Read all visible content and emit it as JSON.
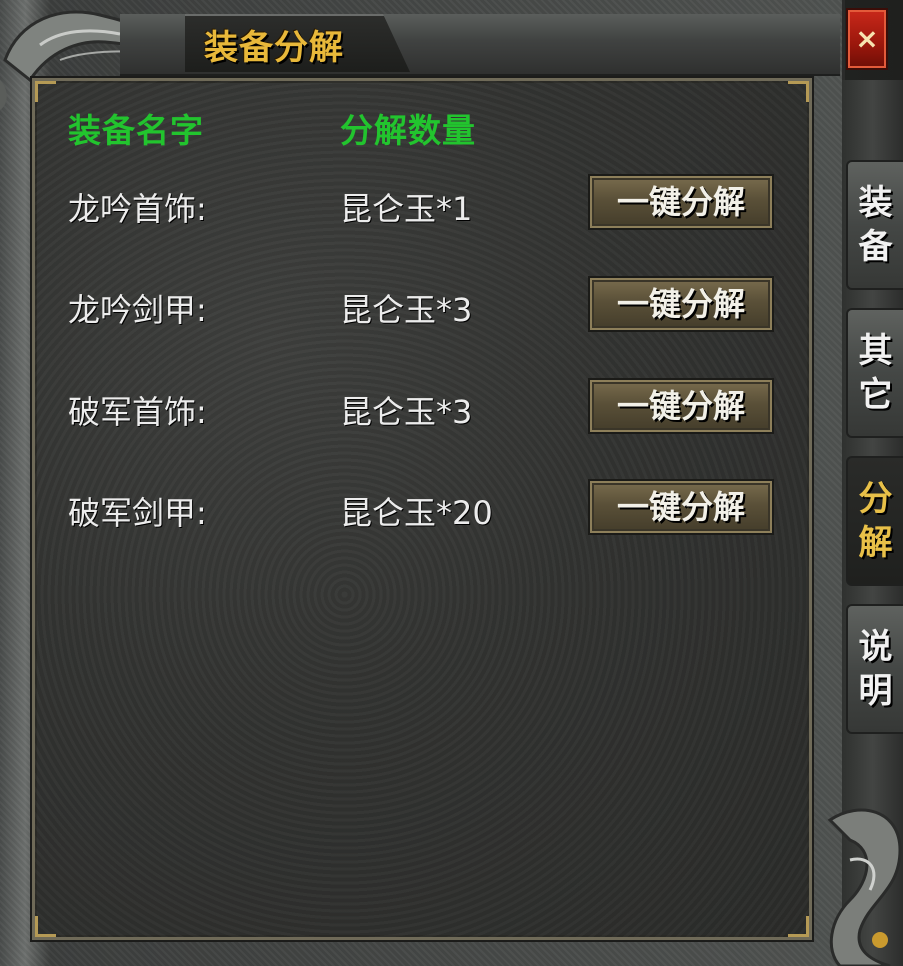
{
  "window": {
    "title": "装备分解",
    "close_label": "×"
  },
  "columns": {
    "name_header": "装备名字",
    "quantity_header": "分解数量"
  },
  "rows": [
    {
      "name": "龙吟首饰:",
      "quantity": "昆仑玉*1",
      "button": "一键分解"
    },
    {
      "name": "龙吟剑甲:",
      "quantity": "昆仑玉*3",
      "button": "一键分解"
    },
    {
      "name": "破军首饰:",
      "quantity": "昆仑玉*3",
      "button": "一键分解"
    },
    {
      "name": "破军剑甲:",
      "quantity": "昆仑玉*20",
      "button": "一键分解"
    }
  ],
  "side_tabs": [
    {
      "label_1": "装",
      "label_2": "备",
      "active": false
    },
    {
      "label_1": "其",
      "label_2": "它",
      "active": false
    },
    {
      "label_1": "分",
      "label_2": "解",
      "active": true
    },
    {
      "label_1": "说",
      "label_2": "明",
      "active": false
    }
  ],
  "colors": {
    "title": "#e8b83a",
    "header_green": "#22c42e",
    "text": "#ececec",
    "active_tab_text": "#e8c048"
  }
}
